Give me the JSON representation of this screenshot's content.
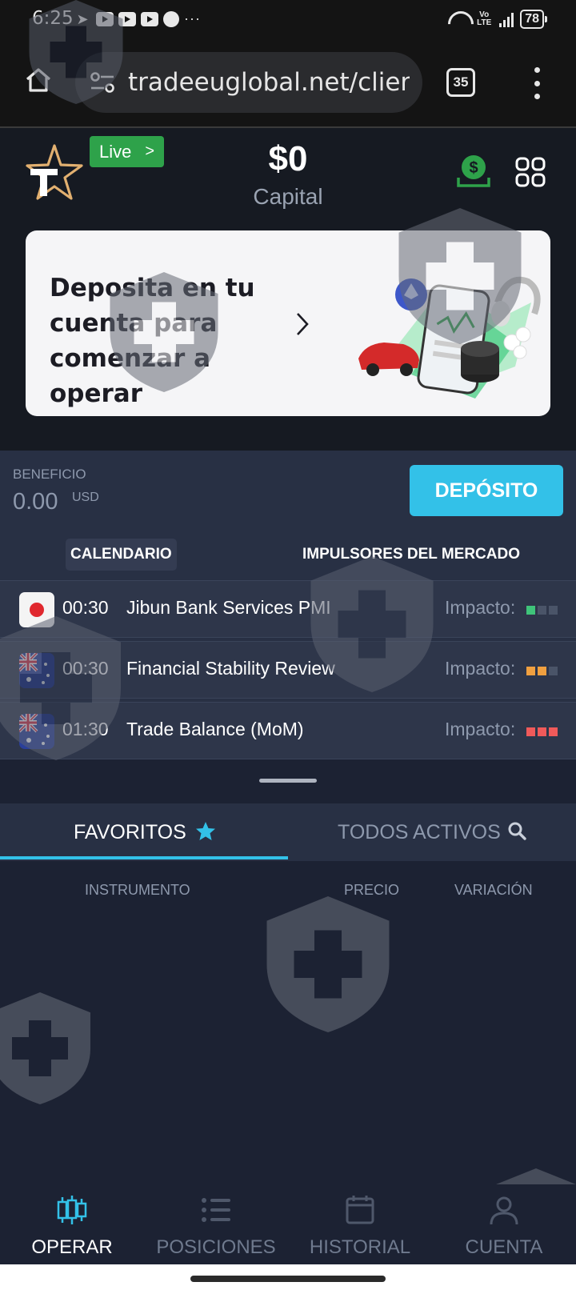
{
  "status_bar": {
    "time": "6:25",
    "volte": "Vo LTE",
    "battery": "78"
  },
  "browser": {
    "url": "tradeeuglobal.net/client-",
    "tab_count": "35"
  },
  "header": {
    "live_label": "Live",
    "capital_value": "$0",
    "capital_label": "Capital"
  },
  "promo": {
    "text": "Deposita en tu cuenta para comenzar a operar"
  },
  "profit": {
    "label": "BENEFICIO",
    "value": "0.00",
    "unit": "USD",
    "deposit_button": "DEPÓSITO"
  },
  "calendar_tabs": [
    "CALENDARIO",
    "IMPULSORES DEL MERCADO"
  ],
  "events": [
    {
      "time": "00:30",
      "name": "Jibun Bank Services PMI",
      "impact_label": "Impacto:",
      "flag": "japan-flag",
      "impact_level": 1,
      "impact_color": "#3fc47a"
    },
    {
      "time": "00:30",
      "name": "Financial Stability Review",
      "impact_label": "Impacto:",
      "flag": "australia-flag",
      "impact_level": 2,
      "impact_color": "#f0a040"
    },
    {
      "time": "01:30",
      "name": "Trade Balance (MoM)",
      "impact_label": "Impacto:",
      "flag": "australia-flag",
      "impact_level": 3,
      "impact_color": "#f05a5a"
    }
  ],
  "asset_tabs": {
    "favorites": "FAVORITOS",
    "all": "TODOS ACTIVOS"
  },
  "columns": {
    "instrument": "INSTRUMENTO",
    "price": "PRECIO",
    "change": "VARIACIÓN"
  },
  "bottom_nav": [
    {
      "label": "OPERAR",
      "icon": "candlestick-icon",
      "active": true
    },
    {
      "label": "POSICIONES",
      "icon": "list-icon",
      "active": false
    },
    {
      "label": "HISTORIAL",
      "icon": "calendar-icon",
      "active": false
    },
    {
      "label": "CUENTA",
      "icon": "user-icon",
      "active": false
    }
  ],
  "colors": {
    "accent": "#33c1e8",
    "live_green": "#2ea24a",
    "background": "#1c2233"
  }
}
